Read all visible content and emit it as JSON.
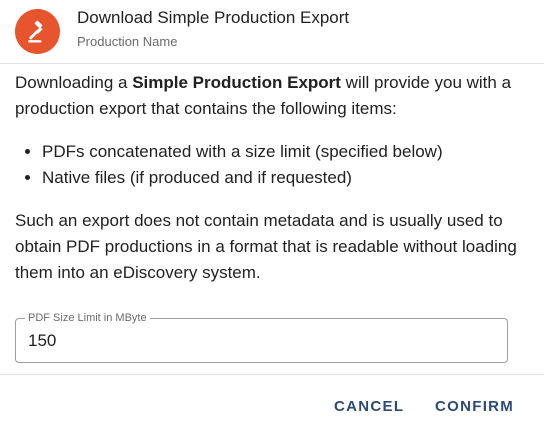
{
  "dialog": {
    "title": "Download Simple Production Export",
    "subtitle": "Production Name",
    "icon": "gavel-icon",
    "accent_color": "#e6552e",
    "intro_prefix": "Downloading a ",
    "intro_bold": "Simple Production Export",
    "intro_suffix": " will provide you with a production export that contains the following items:",
    "items": [
      "PDFs concatenated with a size limit (specified below)",
      "Native files (if produced and if requested)"
    ],
    "description": "Such an export does not contain metadata and is usually used to obtain PDF productions in a format that is readable without loading them into an eDiscovery system.",
    "pdf_size_field": {
      "label": "PDF Size Limit in MByte",
      "value": "150"
    },
    "actions": {
      "cancel_label": "CANCEL",
      "confirm_label": "CONFIRM",
      "button_color": "#2c4a76"
    }
  }
}
